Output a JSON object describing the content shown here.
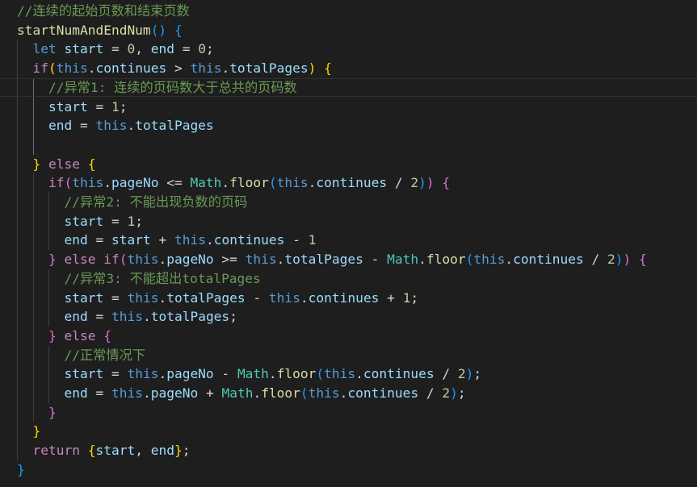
{
  "editor": {
    "background": "#1e1e1e",
    "theme_colors": {
      "comment": "#6a9955",
      "function": "#dcdcaa",
      "keyword": "#569cd6",
      "control": "#c586c0",
      "variable": "#9cdcfe",
      "number": "#b5cea8",
      "operator": "#d4d4d4",
      "class": "#4ec9b0",
      "bracket_level_1": "#ffd700",
      "bracket_level_2": "#da70d6",
      "bracket_level_3": "#179fff"
    },
    "current_line": 4,
    "lines": [
      [
        {
          "t": "//连续的起始页数和结束页数",
          "c": "comment"
        }
      ],
      [
        {
          "t": "startNumAndEndNum",
          "c": "func"
        },
        {
          "t": "() ",
          "c": "b3"
        },
        {
          "t": "{",
          "c": "b3"
        }
      ],
      [
        {
          "t": "  ",
          "c": "plain"
        },
        {
          "t": "let",
          "c": "keyword"
        },
        {
          "t": " ",
          "c": "plain"
        },
        {
          "t": "start",
          "c": "var"
        },
        {
          "t": " = ",
          "c": "op"
        },
        {
          "t": "0",
          "c": "num"
        },
        {
          "t": ", ",
          "c": "plain"
        },
        {
          "t": "end",
          "c": "var"
        },
        {
          "t": " = ",
          "c": "op"
        },
        {
          "t": "0",
          "c": "num"
        },
        {
          "t": ";",
          "c": "plain"
        }
      ],
      [
        {
          "t": "  ",
          "c": "plain"
        },
        {
          "t": "if",
          "c": "control"
        },
        {
          "t": "(",
          "c": "b1"
        },
        {
          "t": "this",
          "c": "keyword"
        },
        {
          "t": ".",
          "c": "plain"
        },
        {
          "t": "continues",
          "c": "var"
        },
        {
          "t": " > ",
          "c": "op"
        },
        {
          "t": "this",
          "c": "keyword"
        },
        {
          "t": ".",
          "c": "plain"
        },
        {
          "t": "totalPages",
          "c": "var"
        },
        {
          "t": ")",
          "c": "b1"
        },
        {
          "t": " ",
          "c": "plain"
        },
        {
          "t": "{",
          "c": "b1"
        }
      ],
      [
        {
          "t": "    ",
          "c": "plain"
        },
        {
          "t": "//异常1: 连续的页码数大于总共的页码数",
          "c": "comment"
        }
      ],
      [
        {
          "t": "    ",
          "c": "plain"
        },
        {
          "t": "start",
          "c": "var"
        },
        {
          "t": " = ",
          "c": "op"
        },
        {
          "t": "1",
          "c": "num"
        },
        {
          "t": ";",
          "c": "plain"
        }
      ],
      [
        {
          "t": "    ",
          "c": "plain"
        },
        {
          "t": "end",
          "c": "var"
        },
        {
          "t": " = ",
          "c": "op"
        },
        {
          "t": "this",
          "c": "keyword"
        },
        {
          "t": ".",
          "c": "plain"
        },
        {
          "t": "totalPages",
          "c": "var"
        }
      ],
      [],
      [
        {
          "t": "  ",
          "c": "plain"
        },
        {
          "t": "}",
          "c": "b1"
        },
        {
          "t": " ",
          "c": "plain"
        },
        {
          "t": "else",
          "c": "control"
        },
        {
          "t": " ",
          "c": "plain"
        },
        {
          "t": "{",
          "c": "b1"
        }
      ],
      [
        {
          "t": "    ",
          "c": "plain"
        },
        {
          "t": "if",
          "c": "control"
        },
        {
          "t": "(",
          "c": "b2"
        },
        {
          "t": "this",
          "c": "keyword"
        },
        {
          "t": ".",
          "c": "plain"
        },
        {
          "t": "pageNo",
          "c": "var"
        },
        {
          "t": " <= ",
          "c": "op"
        },
        {
          "t": "Math",
          "c": "class"
        },
        {
          "t": ".",
          "c": "plain"
        },
        {
          "t": "floor",
          "c": "func"
        },
        {
          "t": "(",
          "c": "b3"
        },
        {
          "t": "this",
          "c": "keyword"
        },
        {
          "t": ".",
          "c": "plain"
        },
        {
          "t": "continues",
          "c": "var"
        },
        {
          "t": " / ",
          "c": "op"
        },
        {
          "t": "2",
          "c": "num"
        },
        {
          "t": ")",
          "c": "b3"
        },
        {
          "t": ")",
          "c": "b2"
        },
        {
          "t": " ",
          "c": "plain"
        },
        {
          "t": "{",
          "c": "b2"
        }
      ],
      [
        {
          "t": "      ",
          "c": "plain"
        },
        {
          "t": "//异常2: 不能出现负数的页码",
          "c": "comment"
        }
      ],
      [
        {
          "t": "      ",
          "c": "plain"
        },
        {
          "t": "start",
          "c": "var"
        },
        {
          "t": " = ",
          "c": "op"
        },
        {
          "t": "1",
          "c": "num"
        },
        {
          "t": ";",
          "c": "plain"
        }
      ],
      [
        {
          "t": "      ",
          "c": "plain"
        },
        {
          "t": "end",
          "c": "var"
        },
        {
          "t": " = ",
          "c": "op"
        },
        {
          "t": "start",
          "c": "var"
        },
        {
          "t": " + ",
          "c": "op"
        },
        {
          "t": "this",
          "c": "keyword"
        },
        {
          "t": ".",
          "c": "plain"
        },
        {
          "t": "continues",
          "c": "var"
        },
        {
          "t": " - ",
          "c": "op"
        },
        {
          "t": "1",
          "c": "num"
        }
      ],
      [
        {
          "t": "    ",
          "c": "plain"
        },
        {
          "t": "}",
          "c": "b2"
        },
        {
          "t": " ",
          "c": "plain"
        },
        {
          "t": "else",
          "c": "control"
        },
        {
          "t": " ",
          "c": "plain"
        },
        {
          "t": "if",
          "c": "control"
        },
        {
          "t": "(",
          "c": "b2"
        },
        {
          "t": "this",
          "c": "keyword"
        },
        {
          "t": ".",
          "c": "plain"
        },
        {
          "t": "pageNo",
          "c": "var"
        },
        {
          "t": " >= ",
          "c": "op"
        },
        {
          "t": "this",
          "c": "keyword"
        },
        {
          "t": ".",
          "c": "plain"
        },
        {
          "t": "totalPages",
          "c": "var"
        },
        {
          "t": " - ",
          "c": "op"
        },
        {
          "t": "Math",
          "c": "class"
        },
        {
          "t": ".",
          "c": "plain"
        },
        {
          "t": "floor",
          "c": "func"
        },
        {
          "t": "(",
          "c": "b3"
        },
        {
          "t": "this",
          "c": "keyword"
        },
        {
          "t": ".",
          "c": "plain"
        },
        {
          "t": "continues",
          "c": "var"
        },
        {
          "t": " / ",
          "c": "op"
        },
        {
          "t": "2",
          "c": "num"
        },
        {
          "t": ")",
          "c": "b3"
        },
        {
          "t": ")",
          "c": "b2"
        },
        {
          "t": " ",
          "c": "plain"
        },
        {
          "t": "{",
          "c": "b2"
        }
      ],
      [
        {
          "t": "      ",
          "c": "plain"
        },
        {
          "t": "//异常3: 不能超出totalPages",
          "c": "comment"
        }
      ],
      [
        {
          "t": "      ",
          "c": "plain"
        },
        {
          "t": "start",
          "c": "var"
        },
        {
          "t": " = ",
          "c": "op"
        },
        {
          "t": "this",
          "c": "keyword"
        },
        {
          "t": ".",
          "c": "plain"
        },
        {
          "t": "totalPages",
          "c": "var"
        },
        {
          "t": " - ",
          "c": "op"
        },
        {
          "t": "this",
          "c": "keyword"
        },
        {
          "t": ".",
          "c": "plain"
        },
        {
          "t": "continues",
          "c": "var"
        },
        {
          "t": " + ",
          "c": "op"
        },
        {
          "t": "1",
          "c": "num"
        },
        {
          "t": ";",
          "c": "plain"
        }
      ],
      [
        {
          "t": "      ",
          "c": "plain"
        },
        {
          "t": "end",
          "c": "var"
        },
        {
          "t": " = ",
          "c": "op"
        },
        {
          "t": "this",
          "c": "keyword"
        },
        {
          "t": ".",
          "c": "plain"
        },
        {
          "t": "totalPages",
          "c": "var"
        },
        {
          "t": ";",
          "c": "plain"
        }
      ],
      [
        {
          "t": "    ",
          "c": "plain"
        },
        {
          "t": "}",
          "c": "b2"
        },
        {
          "t": " ",
          "c": "plain"
        },
        {
          "t": "else",
          "c": "control"
        },
        {
          "t": " ",
          "c": "plain"
        },
        {
          "t": "{",
          "c": "b2"
        }
      ],
      [
        {
          "t": "      ",
          "c": "plain"
        },
        {
          "t": "//正常情况下",
          "c": "comment"
        }
      ],
      [
        {
          "t": "      ",
          "c": "plain"
        },
        {
          "t": "start",
          "c": "var"
        },
        {
          "t": " = ",
          "c": "op"
        },
        {
          "t": "this",
          "c": "keyword"
        },
        {
          "t": ".",
          "c": "plain"
        },
        {
          "t": "pageNo",
          "c": "var"
        },
        {
          "t": " - ",
          "c": "op"
        },
        {
          "t": "Math",
          "c": "class"
        },
        {
          "t": ".",
          "c": "plain"
        },
        {
          "t": "floor",
          "c": "func"
        },
        {
          "t": "(",
          "c": "b3"
        },
        {
          "t": "this",
          "c": "keyword"
        },
        {
          "t": ".",
          "c": "plain"
        },
        {
          "t": "continues",
          "c": "var"
        },
        {
          "t": " / ",
          "c": "op"
        },
        {
          "t": "2",
          "c": "num"
        },
        {
          "t": ")",
          "c": "b3"
        },
        {
          "t": ";",
          "c": "plain"
        }
      ],
      [
        {
          "t": "      ",
          "c": "plain"
        },
        {
          "t": "end",
          "c": "var"
        },
        {
          "t": " = ",
          "c": "op"
        },
        {
          "t": "this",
          "c": "keyword"
        },
        {
          "t": ".",
          "c": "plain"
        },
        {
          "t": "pageNo",
          "c": "var"
        },
        {
          "t": " + ",
          "c": "op"
        },
        {
          "t": "Math",
          "c": "class"
        },
        {
          "t": ".",
          "c": "plain"
        },
        {
          "t": "floor",
          "c": "func"
        },
        {
          "t": "(",
          "c": "b3"
        },
        {
          "t": "this",
          "c": "keyword"
        },
        {
          "t": ".",
          "c": "plain"
        },
        {
          "t": "continues",
          "c": "var"
        },
        {
          "t": " / ",
          "c": "op"
        },
        {
          "t": "2",
          "c": "num"
        },
        {
          "t": ")",
          "c": "b3"
        },
        {
          "t": ";",
          "c": "plain"
        }
      ],
      [
        {
          "t": "    ",
          "c": "plain"
        },
        {
          "t": "}",
          "c": "b2"
        }
      ],
      [
        {
          "t": "  ",
          "c": "plain"
        },
        {
          "t": "}",
          "c": "b1"
        }
      ],
      [
        {
          "t": "  ",
          "c": "plain"
        },
        {
          "t": "return",
          "c": "control"
        },
        {
          "t": " ",
          "c": "plain"
        },
        {
          "t": "{",
          "c": "b1"
        },
        {
          "t": "start",
          "c": "var"
        },
        {
          "t": ", ",
          "c": "plain"
        },
        {
          "t": "end",
          "c": "var"
        },
        {
          "t": "}",
          "c": "b1"
        },
        {
          "t": ";",
          "c": "plain"
        }
      ],
      [
        {
          "t": "}",
          "c": "b3"
        }
      ]
    ]
  }
}
